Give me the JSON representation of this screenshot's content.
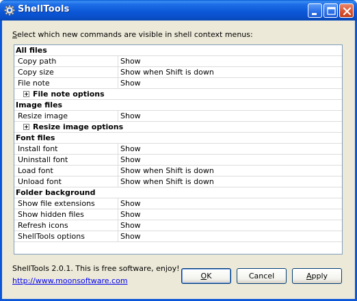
{
  "window": {
    "title": "ShellTools",
    "buttons": [
      "minimize",
      "maximize",
      "close"
    ]
  },
  "prompt": {
    "accel": "S",
    "rest": "elect which new commands are visible in shell context menus:"
  },
  "groups": [
    {
      "title": "All files",
      "rows": [
        {
          "name": "Copy path",
          "value": "Show"
        },
        {
          "name": "Copy size",
          "value": "Show when Shift is down"
        },
        {
          "name": "File note",
          "value": "Show"
        }
      ],
      "sub": "File note options"
    },
    {
      "title": "Image files",
      "rows": [
        {
          "name": "Resize image",
          "value": "Show"
        }
      ],
      "sub": "Resize image options"
    },
    {
      "title": "Font files",
      "rows": [
        {
          "name": "Install font",
          "value": "Show"
        },
        {
          "name": "Uninstall font",
          "value": "Show"
        },
        {
          "name": "Load font",
          "value": "Show when Shift is down"
        },
        {
          "name": "Unload font",
          "value": "Show when Shift is down"
        }
      ]
    },
    {
      "title": "Folder background",
      "rows": [
        {
          "name": "Show file extensions",
          "value": "Show"
        },
        {
          "name": "Show hidden files",
          "value": "Show"
        },
        {
          "name": "Refresh icons",
          "value": "Show"
        },
        {
          "name": "ShellTools options",
          "value": "Show"
        }
      ]
    }
  ],
  "footer": {
    "info": "ShellTools 2.0.1. This is free software, enjoy!",
    "link": "http://www.moonsoftware.com"
  },
  "buttons": {
    "ok": {
      "accel": "O",
      "rest": "K"
    },
    "cancel": "Cancel",
    "apply": {
      "accel": "A",
      "rest": "pply"
    }
  }
}
